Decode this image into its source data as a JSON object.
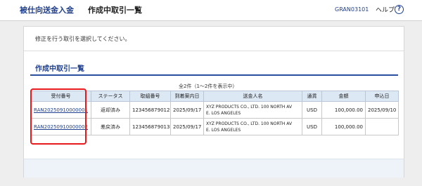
{
  "header": {
    "brand": "被仕向送金入金",
    "page_title": "作成中取引一覧",
    "screen_id": "GRAN03101",
    "help_label": "ヘルプ",
    "help_icon": "question-circle-icon"
  },
  "main": {
    "instruction": "修正を行う取引を選択してください。",
    "section_title": "作成中取引一覧",
    "count_text": "全2件（1～2件を表示中）"
  },
  "table": {
    "columns": [
      "受付番号",
      "ステータス",
      "取組番号",
      "到着案内日",
      "送金人名",
      "通貨",
      "金額",
      "申込日"
    ],
    "rows": [
      {
        "receipt_no": "RAN20250910000001",
        "status": "返却済み",
        "transaction_no": "123456879012",
        "arrival_date": "2025/09/17",
        "remitter_line1": "XYZ PRODUCTS CO., LTD. 100 NORTH AV",
        "remitter_line2": "E. LOS ANGELES",
        "currency": "USD",
        "amount": "100,000.00",
        "application_date": "2025/09/10"
      },
      {
        "receipt_no": "RAN20250910000002",
        "status": "差戻済み",
        "transaction_no": "123456879013",
        "arrival_date": "2025/09/17",
        "remitter_line1": "XYZ PRODUCTS CO., LTD. 100 NORTH AV",
        "remitter_line2": "E. LOS ANGELES",
        "currency": "USD",
        "amount": "100,000.00",
        "application_date": ""
      }
    ]
  },
  "colors": {
    "brand": "#1f3f8f",
    "header_bg": "#dde8f5",
    "highlight": "#e8191d"
  }
}
